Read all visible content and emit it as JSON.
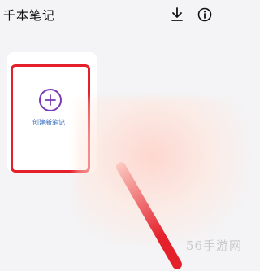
{
  "header": {
    "title": "千本笔记"
  },
  "icons": {
    "download": "download-icon",
    "info": "info-icon",
    "add": "plus-icon"
  },
  "note_card": {
    "create_label": "创建新笔记"
  },
  "colors": {
    "highlight": "#e4202b",
    "accent": "#7a3ab8",
    "label": "#3a6fc0"
  },
  "watermark": "56手游网"
}
